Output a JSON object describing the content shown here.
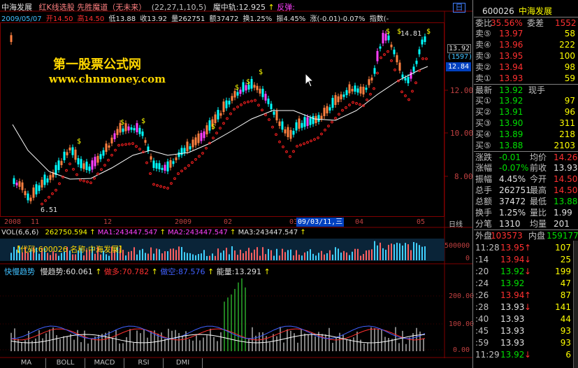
{
  "header": {
    "stock_name": "中海发展",
    "indicator_name": "红K线选股 先胜魔道（无未来）",
    "indicator_params": "(22,27,1,10,5)",
    "magic_line": "魔中轨:12.925",
    "reverse": "反弹:",
    "up_marker": "↑"
  },
  "info_line": {
    "date": "2009/05/07",
    "open": "开14.50",
    "high": "高14.50",
    "low": "低13.88",
    "close": "收13.92",
    "volume": "量262751",
    "amount": "额37472",
    "turnover": "换1.25%",
    "amplitude": "振4.45%",
    "change": "涨(-0.01)-0.07%",
    "index": "指数(-",
    "day_button": "日"
  },
  "watermark": {
    "line1": "第一股票公式网",
    "line2": "www.chnmoney.com"
  },
  "price_axis": {
    "ticks": [
      "12.00",
      "10.00",
      "8.00"
    ],
    "current_price": "13.92",
    "current_volume": "(1597)",
    "highlight": "12.84",
    "peak_label": "14.81",
    "low_label": "6.51"
  },
  "time_axis": {
    "labels": [
      "2008",
      "11",
      "12",
      "2009",
      "02",
      "03",
      "04",
      "05"
    ],
    "cursor_label": "09/03/11,三",
    "period": "日线"
  },
  "vol_panel": {
    "title": "VOL(6,6,6)",
    "vol": "262750.594",
    "ma1": "MA1:243447.547",
    "ma2": "MA2:243447.547",
    "ma3": "MA3:243447.547",
    "arrow": "↑",
    "code_banner": "【代码:600026 名称:中海发展】",
    "axis_top": "500000",
    "axis_zero": "0"
  },
  "trend_panel": {
    "title": "快慢趋势",
    "slow": "慢趋势:60.061",
    "long": "做多:70.782",
    "short": "做空:87.576",
    "energy": "能量:13.291",
    "arrow": "↑",
    "axis": [
      "200.00",
      "100.00",
      "0.00"
    ]
  },
  "tabs": [
    "MA",
    "BOLL",
    "MACD",
    "RSI",
    "DMI"
  ],
  "quote": {
    "code": "600026",
    "name": "中海发展",
    "weibi_label": "委比",
    "weibi": "35.56%",
    "weicha_label": "委差",
    "weicha": "1552",
    "asks": [
      {
        "label": "卖⑤",
        "price": "13.97",
        "vol": "58"
      },
      {
        "label": "卖④",
        "price": "13.96",
        "vol": "222"
      },
      {
        "label": "卖③",
        "price": "13.95",
        "vol": "100"
      },
      {
        "label": "卖②",
        "price": "13.94",
        "vol": "98"
      },
      {
        "label": "卖①",
        "price": "13.93",
        "vol": "59"
      }
    ],
    "latest_label": "最新",
    "latest": "13.92",
    "hand_label": "现手",
    "bids": [
      {
        "label": "买①",
        "price": "13.92",
        "vol": "97"
      },
      {
        "label": "买②",
        "price": "13.91",
        "vol": "96"
      },
      {
        "label": "买③",
        "price": "13.90",
        "vol": "311"
      },
      {
        "label": "买④",
        "price": "13.89",
        "vol": "218"
      },
      {
        "label": "买⑤",
        "price": "13.88",
        "vol": "2103"
      }
    ],
    "stats": [
      {
        "l1": "涨跌",
        "v1": "-0.01",
        "l2": "均价",
        "v2": "14.26",
        "c1": "green",
        "c2": "red"
      },
      {
        "l1": "涨幅",
        "v1": "-0.07%",
        "l2": "前收",
        "v2": "13.93",
        "c1": "green",
        "c2": "white"
      },
      {
        "l1": "振幅",
        "v1": "4.45%",
        "l2": "今开",
        "v2": "14.50",
        "c1": "white",
        "c2": "red"
      },
      {
        "l1": "总手",
        "v1": "262751",
        "l2": "最高",
        "v2": "14.50",
        "c1": "white",
        "c2": "red"
      },
      {
        "l1": "总额",
        "v1": "37472",
        "l2": "最低",
        "v2": "13.88",
        "c1": "white",
        "c2": "green"
      },
      {
        "l1": "换手",
        "v1": "1.25%",
        "l2": "量比",
        "v2": "1.99",
        "c1": "white",
        "c2": "white"
      },
      {
        "l1": "分笔",
        "v1": "1310",
        "l2": "均量",
        "v2": "201",
        "c1": "white",
        "c2": "white"
      }
    ],
    "outer_label": "外盘",
    "outer": "103573",
    "inner_label": "内盘",
    "inner": "159177",
    "ticks": [
      {
        "time": "11:28",
        "price": "13.95",
        "arrow": "↑",
        "vol": "107",
        "pc": "red"
      },
      {
        "time": ":14",
        "price": "13.94",
        "arrow": "↓",
        "vol": "25",
        "pc": "red"
      },
      {
        "time": ":20",
        "price": "13.92",
        "arrow": "↓",
        "vol": "199",
        "pc": "green"
      },
      {
        "time": ":24",
        "price": "13.92",
        "arrow": "",
        "vol": "47",
        "pc": "green"
      },
      {
        "time": ":26",
        "price": "13.94",
        "arrow": "↑",
        "vol": "87",
        "pc": "red"
      },
      {
        "time": ":28",
        "price": "13.93",
        "arrow": "↓",
        "vol": "141",
        "pc": "white"
      },
      {
        "time": ":40",
        "price": "13.93",
        "arrow": "",
        "vol": "44",
        "pc": "white"
      },
      {
        "time": ":45",
        "price": "13.93",
        "arrow": "",
        "vol": "93",
        "pc": "white"
      },
      {
        "time": ":59",
        "price": "13.93",
        "arrow": "",
        "vol": "93",
        "pc": "white"
      },
      {
        "time": "11:29",
        "price": "13.92",
        "arrow": "↓",
        "vol": "6",
        "pc": "green"
      }
    ]
  },
  "colors": {
    "up": "#ff5050",
    "down": "#00ffff",
    "grid": "#800000",
    "ma_white": "#ffffff",
    "sar_red": "#ff2020",
    "accent_yellow": "#ffff00"
  }
}
